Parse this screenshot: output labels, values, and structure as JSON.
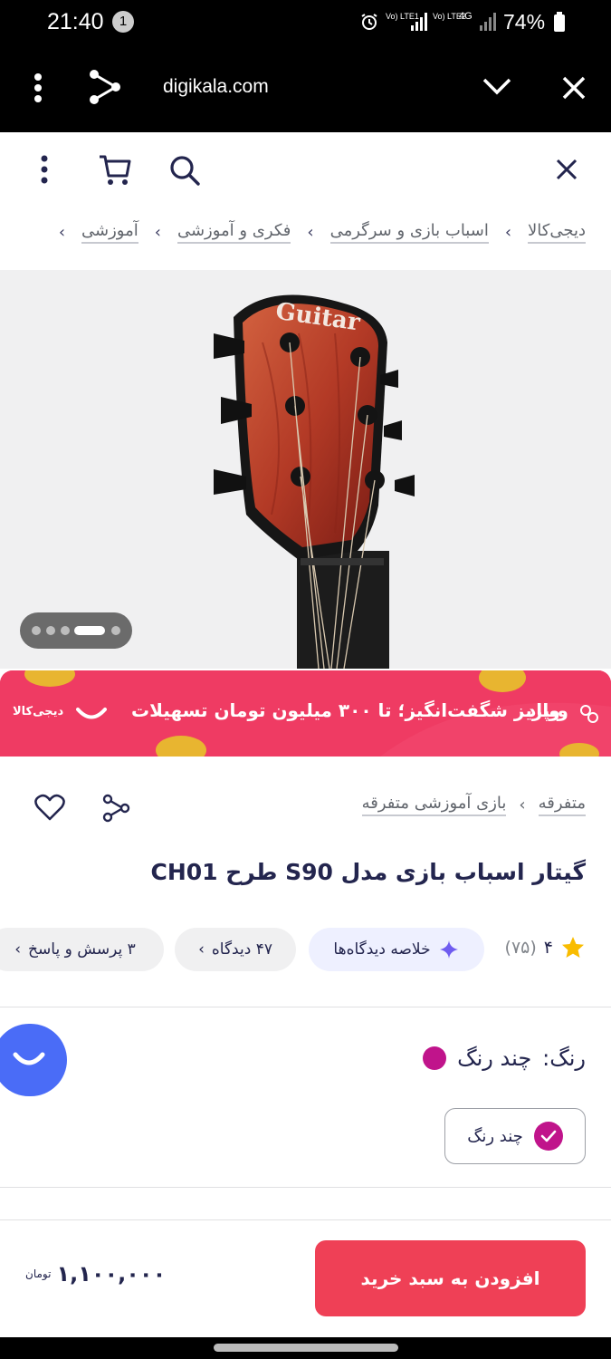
{
  "status_bar": {
    "time": "21:40",
    "notification_count": "1",
    "lte1": "Vo) LTE1",
    "lte2": "Vo) LTE2",
    "net": "4G",
    "battery": "74%"
  },
  "browser": {
    "url": "digikala.com"
  },
  "breadcrumb": {
    "items": [
      "دیجی‌کالا",
      "اسباب بازی و سرگرمی",
      "فکری و آموزشی",
      "آموزشی"
    ]
  },
  "gallery": {
    "headstock_text": "Guitar",
    "current_slide": 4,
    "total_slides": 5
  },
  "banner": {
    "brand": "ویپاد",
    "text": "واریز شگفت‌انگیز؛ تا ۳۰۰ میلیون تومان تسهیلات",
    "logo_text": "دیجی‌کالا"
  },
  "category_path": {
    "items": [
      "متفرقه",
      "بازی آموزشی متفرقه"
    ]
  },
  "product": {
    "title": "گیتار اسباب بازی مدل S90 طرح CH01",
    "rating": "۴",
    "rating_count": "(۷۵)",
    "summary_chip": "خلاصه دیدگاه‌ها",
    "comments_chip": "۴۷ دیدگاه",
    "qa_chip": "۳ پرسش و پاسخ"
  },
  "color": {
    "label": "رنگ:",
    "value": "چند رنگ",
    "option_label": "چند رنگ",
    "swatch": "#c0148b"
  },
  "purchase": {
    "add_to_cart": "افزودن به سبد خرید",
    "price": "۱,۱۰۰,۰۰۰",
    "currency": "تومان"
  },
  "colors": {
    "accent": "#ef4056",
    "banner": "#ef3b63",
    "assistant": "#4a6cf7"
  }
}
